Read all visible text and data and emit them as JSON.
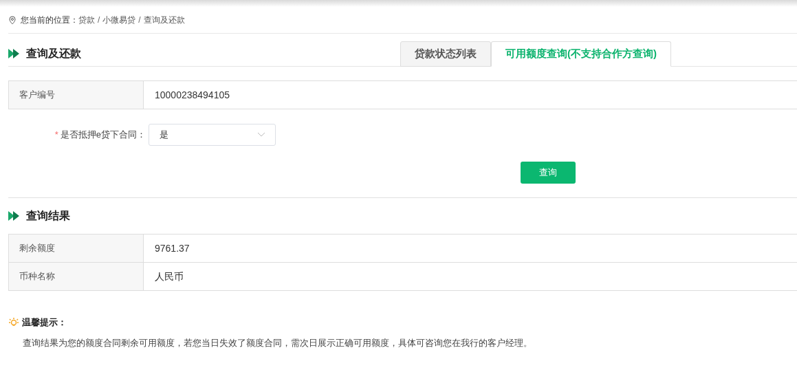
{
  "breadcrumb": {
    "label": "您当前的位置：",
    "items": [
      "贷款",
      "小微易贷",
      "查询及还款"
    ],
    "separator": "/"
  },
  "section_title": "查询及还款",
  "tabs": [
    {
      "label": "贷款状态列表",
      "selected": false
    },
    {
      "label": "可用额度查询(不支持合作方查询)",
      "selected": true
    }
  ],
  "info_table": [
    {
      "label": "客户编号",
      "value": "10000238494105"
    }
  ],
  "form": {
    "label": "是否抵押e贷下合同：",
    "required_mark": "*",
    "value": "是"
  },
  "query_button": "查询",
  "result_title": "查询结果",
  "result_table": [
    {
      "label": "剩余额度",
      "value": "9761.37"
    },
    {
      "label": "币种名称",
      "value": "人民币"
    }
  ],
  "tip": {
    "title": "温馨提示：",
    "text": "查询结果为您的额度合同剩余可用额度，若您当日失效了额度合同，需次日展示正确可用额度，具体可咨询您在我行的客户经理。"
  }
}
